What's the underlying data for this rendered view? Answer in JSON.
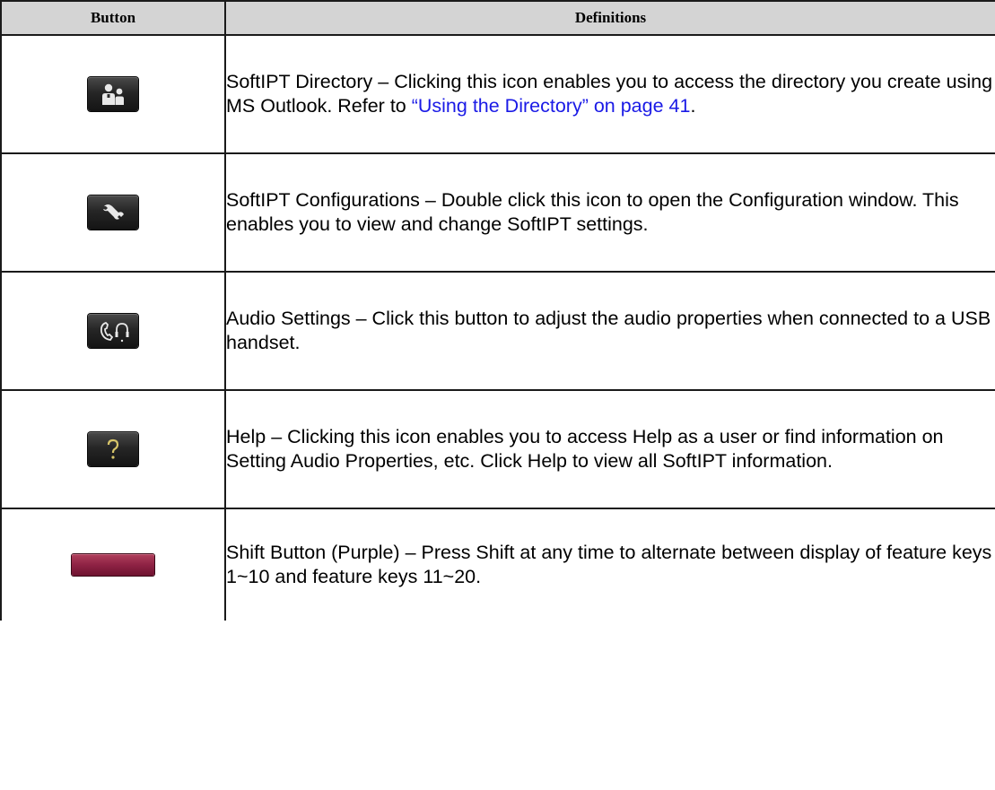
{
  "table": {
    "header": {
      "col1": "Button",
      "col2": "Definitions"
    },
    "rows": [
      {
        "icon": "directory-icon",
        "text_before_link": "SoftIPT Directory –  Clicking this icon enables you to access the directory you create using MS Outlook. Refer to ",
        "link": "“Using the Directory” on page 41",
        "text_after_link": "."
      },
      {
        "icon": "wrench-icon",
        "text": "SoftIPT Configurations – Double click this icon to open the Configuration window. This enables you to view and change SoftIPT settings."
      },
      {
        "icon": "audio-headset-icon",
        "text": "Audio Settings – Click this button to adjust the audio properties when connected to a USB handset."
      },
      {
        "icon": "help-question-icon",
        "text": "Help – Clicking this icon enables you to access Help as a user or find information on Setting Audio Properties, etc. Click Help to view all SoftIPT information."
      },
      {
        "icon": "shift-button-icon",
        "text": "Shift Button (Purple) – Press Shift at any time to alternate between display of feature keys 1~10 and feature keys 11~20."
      }
    ]
  },
  "colors": {
    "link": "#1a1ae6",
    "header_bg": "#d4d4d4",
    "shift_button": "#8e2244"
  }
}
